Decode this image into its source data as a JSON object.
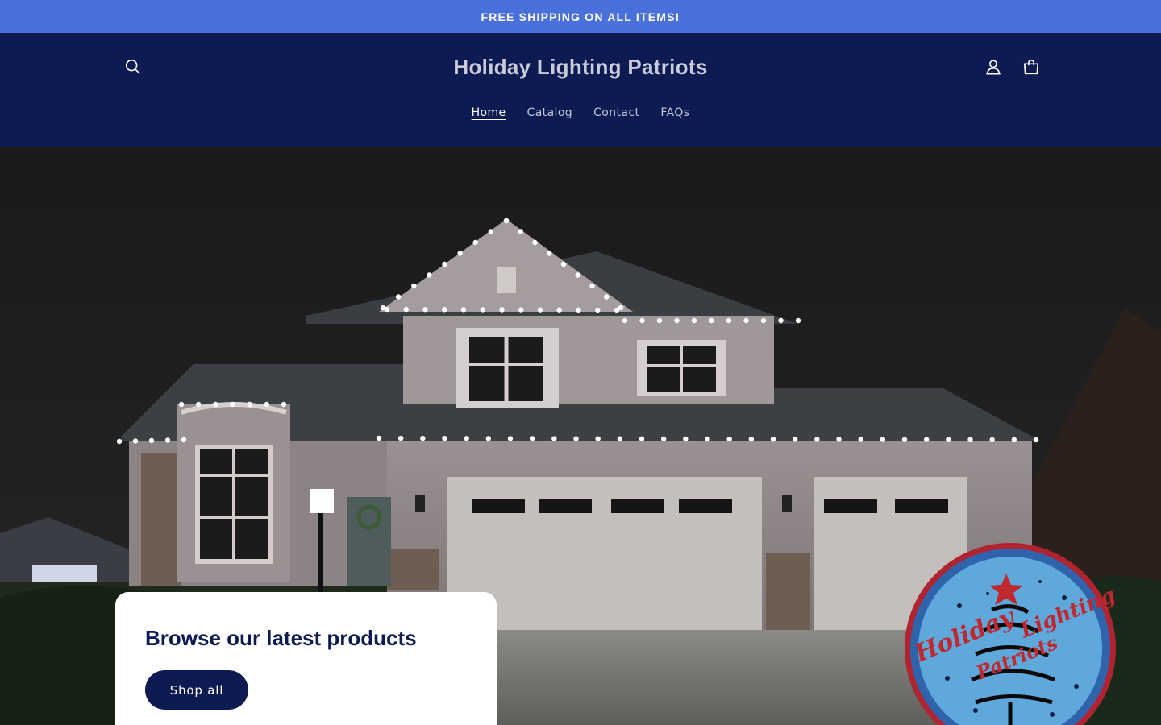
{
  "announcement": {
    "text": "FREE SHIPPING ON ALL ITEMS!"
  },
  "header": {
    "brand": "Holiday Lighting Patriots",
    "icons": {
      "search": "search-icon",
      "account": "user-icon",
      "cart": "bag-icon"
    }
  },
  "nav": {
    "items": [
      {
        "label": "Home",
        "active": true
      },
      {
        "label": "Catalog",
        "active": false
      },
      {
        "label": "Contact",
        "active": false
      },
      {
        "label": "FAQs",
        "active": false
      }
    ]
  },
  "hero": {
    "heading": "Browse our latest products",
    "button_label": "Shop all",
    "logo": {
      "line1": "Holiday",
      "line2": "Lighting",
      "line3": "Patriots"
    }
  },
  "colors": {
    "announcement_bg": "#4a70dc",
    "header_bg": "#0e1b52",
    "button_bg": "#0e1b52",
    "card_bg": "#ffffff"
  }
}
